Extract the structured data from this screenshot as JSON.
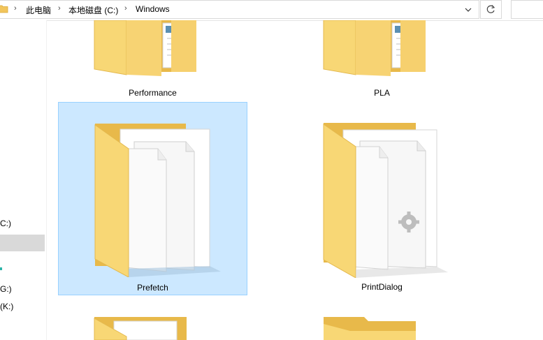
{
  "address": {
    "crumbs": [
      "此电脑",
      "本地磁盘 (C:)",
      "Windows"
    ],
    "separator": "›",
    "dropdown_icon": "chevron-down-icon",
    "refresh_icon": "refresh-icon"
  },
  "nav": {
    "items": [
      {
        "label": "C:)",
        "selected": true
      },
      {
        "label": "G:)"
      },
      {
        "label": "(K:)"
      }
    ]
  },
  "folders": [
    {
      "label": "Performance",
      "kind": "documents"
    },
    {
      "label": "PLA",
      "kind": "documents"
    },
    {
      "label": "Prefetch",
      "kind": "files",
      "selected": true
    },
    {
      "label": "PrintDialog",
      "kind": "files-gear"
    },
    {
      "label": "",
      "kind": "files"
    },
    {
      "label": "",
      "kind": "empty"
    }
  ],
  "colors": {
    "selection_bg": "#cce8ff",
    "selection_border": "#99d1ff",
    "folder_front": "#f8d775",
    "folder_back": "#e8b94a"
  }
}
